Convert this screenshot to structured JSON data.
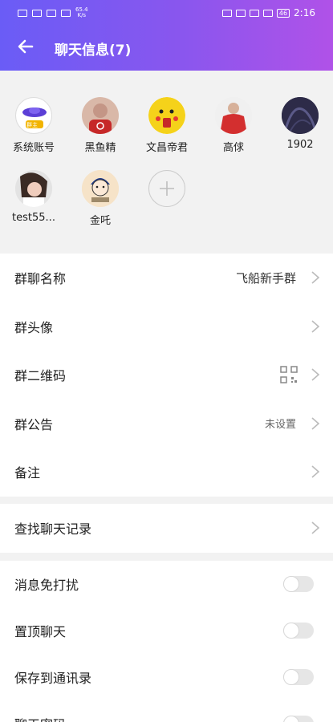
{
  "status_bar": {
    "net_speed": "65.4\nK/s",
    "time": "2:16",
    "battery": "46"
  },
  "header": {
    "title": "聊天信息(7)",
    "back_icon": "arrow-left-icon"
  },
  "members": [
    {
      "name": "系统账号",
      "badge": "群主"
    },
    {
      "name": "黑鱼精"
    },
    {
      "name": "文昌帝君"
    },
    {
      "name": "高俅"
    },
    {
      "name": "1902"
    },
    {
      "name": "test55..."
    },
    {
      "name": "金吒"
    }
  ],
  "group_settings": {
    "name_label": "群聊名称",
    "name_value": "飞船新手群",
    "avatar_label": "群头像",
    "qrcode_label": "群二维码",
    "notice_label": "群公告",
    "notice_value": "未设置",
    "remark_label": "备注"
  },
  "search": {
    "history_label": "查找聊天记录"
  },
  "toggles": {
    "mute_label": "消息免打扰",
    "pin_label": "置顶聊天",
    "save_label": "保存到通讯录",
    "secret_label": "聊天密码"
  },
  "colors": {
    "header_start": "#6a5cf6",
    "header_end": "#b052e8",
    "background": "#f2f2f2"
  }
}
